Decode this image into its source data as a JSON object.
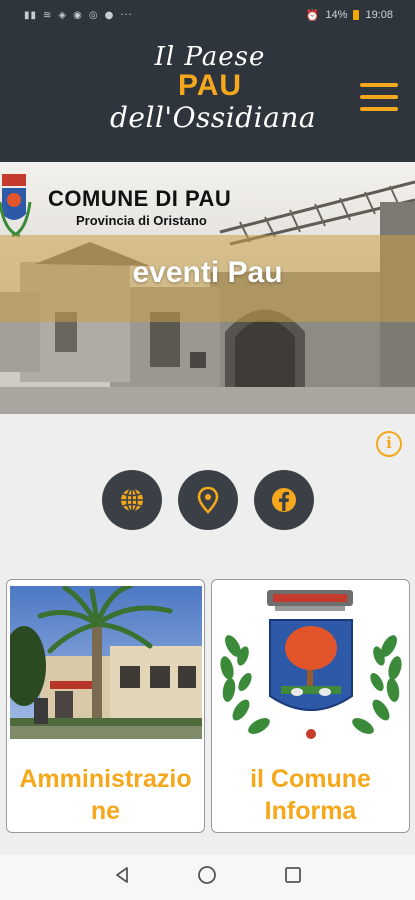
{
  "status_bar": {
    "left_icons": [
      "signal-icon",
      "wifi-icon",
      "nfc-icon",
      "alarm-app-icon",
      "whatsapp-icon",
      "messenger-icon",
      "more-dots-icon"
    ],
    "battery": "14%",
    "time": "19:08"
  },
  "header": {
    "logo_line1": "Il Paese",
    "logo_line2": "PAU",
    "logo_line3": "dell'Ossidiana",
    "menu_icon": "hamburger-menu-icon"
  },
  "banner": {
    "comune_title": "COMUNE DI PAU",
    "comune_subtitle": "Provincia di Oristano",
    "title": "eventi Pau"
  },
  "actions": {
    "info_icon": "info-icon",
    "info_glyph": "i",
    "social": [
      "globe-icon",
      "location-pin-icon",
      "facebook-icon"
    ]
  },
  "cards": [
    {
      "label_line1": "Amministrazio",
      "label_line2": "ne"
    },
    {
      "label_line1": "il Comune",
      "label_line2": "Informa"
    }
  ],
  "nav": [
    "back-icon",
    "home-icon",
    "recents-icon"
  ],
  "colors": {
    "accent": "#f6a81c",
    "header_bg": "#2f353c",
    "button_bg": "#3b4047"
  }
}
